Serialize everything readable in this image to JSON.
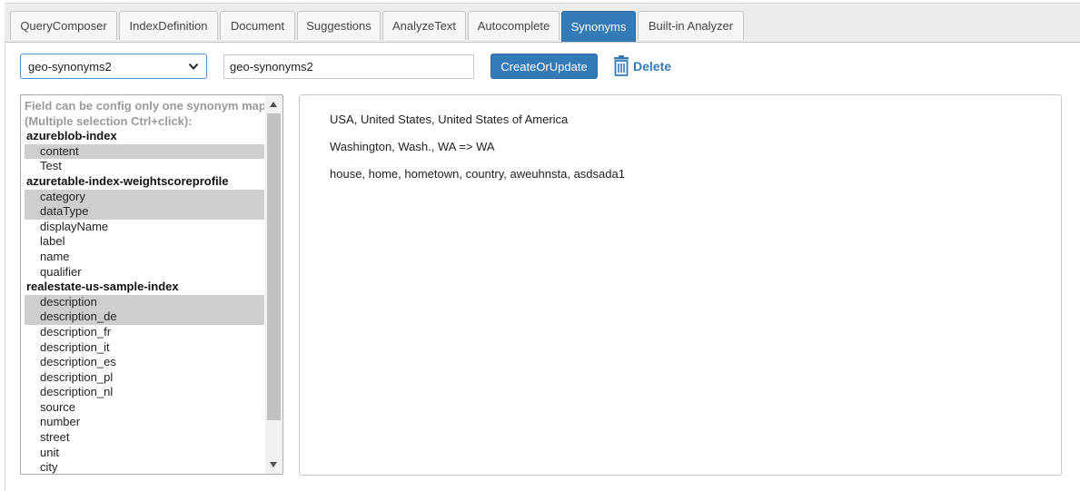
{
  "tabs": [
    {
      "label": "QueryComposer",
      "active": false
    },
    {
      "label": "IndexDefinition",
      "active": false
    },
    {
      "label": "Document",
      "active": false
    },
    {
      "label": "Suggestions",
      "active": false
    },
    {
      "label": "AnalyzeText",
      "active": false
    },
    {
      "label": "Autocomplete",
      "active": false
    },
    {
      "label": "Synonyms",
      "active": true
    },
    {
      "label": "Built-in Analyzer",
      "active": false
    }
  ],
  "toolbar": {
    "synonym_map_selected": "geo-synonyms2",
    "name_input_value": "geo-synonyms2",
    "create_update_label": "CreateOrUpdate",
    "delete_label": "Delete"
  },
  "field_list": {
    "header_lines": [
      "Field can be config only one synonym map",
      "(Multiple selection Ctrl+click):"
    ],
    "items": [
      {
        "kind": "group",
        "text": "azureblob-index"
      },
      {
        "kind": "field",
        "text": "content",
        "selected": true
      },
      {
        "kind": "field",
        "text": "Test",
        "selected": false
      },
      {
        "kind": "group",
        "text": "azuretable-index-weightscoreprofile"
      },
      {
        "kind": "field",
        "text": "category",
        "selected": true
      },
      {
        "kind": "field",
        "text": "dataType",
        "selected": true
      },
      {
        "kind": "field",
        "text": "displayName",
        "selected": false
      },
      {
        "kind": "field",
        "text": "label",
        "selected": false
      },
      {
        "kind": "field",
        "text": "name",
        "selected": false
      },
      {
        "kind": "field",
        "text": "qualifier",
        "selected": false
      },
      {
        "kind": "group",
        "text": "realestate-us-sample-index"
      },
      {
        "kind": "field",
        "text": "description",
        "selected": true
      },
      {
        "kind": "field",
        "text": "description_de",
        "selected": true
      },
      {
        "kind": "field",
        "text": "description_fr",
        "selected": false
      },
      {
        "kind": "field",
        "text": "description_it",
        "selected": false
      },
      {
        "kind": "field",
        "text": "description_es",
        "selected": false
      },
      {
        "kind": "field",
        "text": "description_pl",
        "selected": false
      },
      {
        "kind": "field",
        "text": "description_nl",
        "selected": false
      },
      {
        "kind": "field",
        "text": "source",
        "selected": false
      },
      {
        "kind": "field",
        "text": "number",
        "selected": false
      },
      {
        "kind": "field",
        "text": "street",
        "selected": false
      },
      {
        "kind": "field",
        "text": "unit",
        "selected": false
      },
      {
        "kind": "field",
        "text": "city",
        "selected": false
      }
    ]
  },
  "synonyms_text": {
    "lines": [
      "USA, United States, United States of America",
      "Washington, Wash., WA => WA",
      "house, home, hometown, country, aweuhnsta, asdsada1"
    ]
  },
  "colors": {
    "accent": "#337ab7",
    "selected_option_bg": "#cecece",
    "tabbar_bg": "#ececec"
  }
}
